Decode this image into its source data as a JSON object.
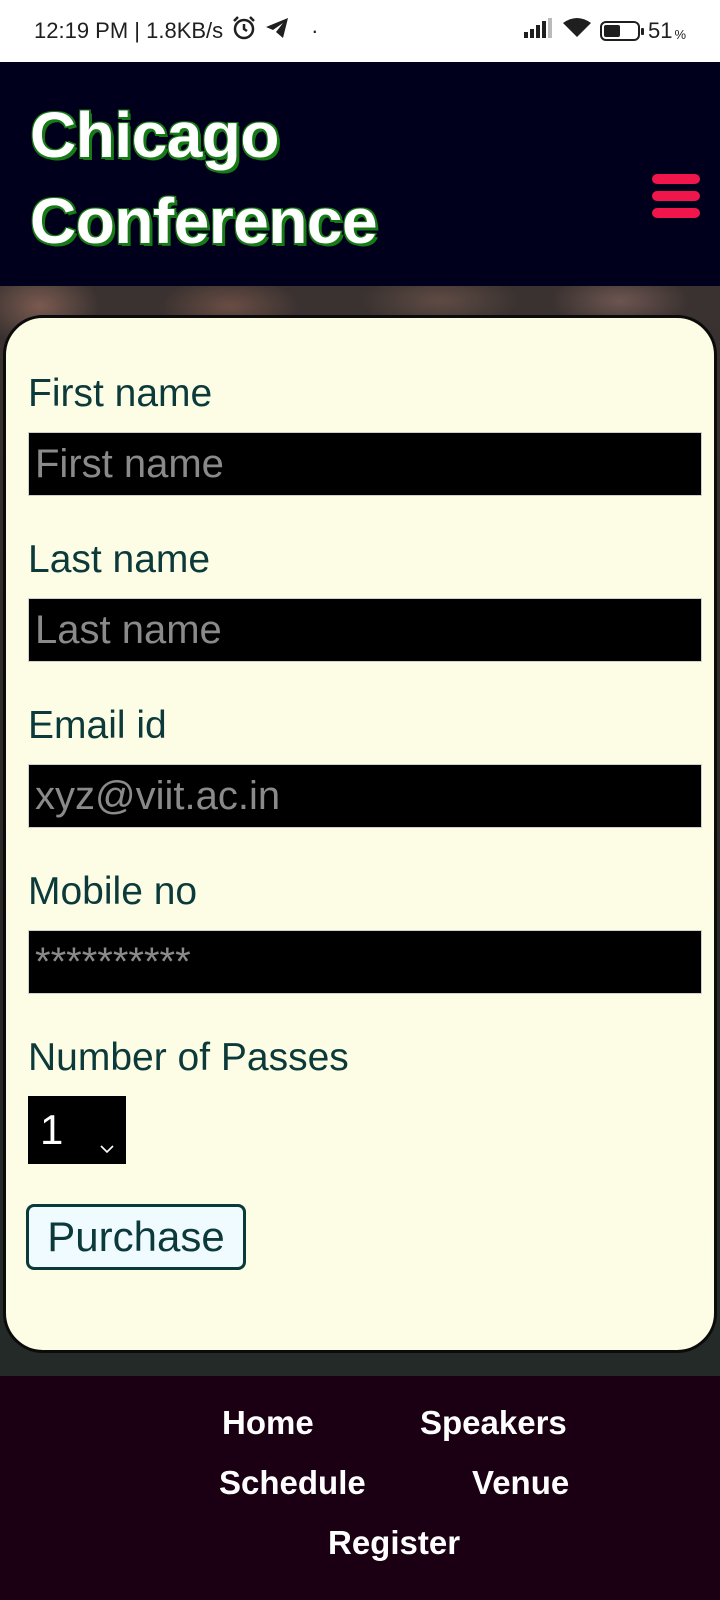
{
  "status_bar": {
    "time_info": "12:19 PM | 1.8KB/s",
    "dot": "·",
    "battery_percent": "51",
    "battery_suffix": "%",
    "battery_level": 0.51
  },
  "header": {
    "title": "Chicago\nConference",
    "title_color": "#ffffff",
    "title_shadow_color": "#167a16",
    "background_color": "#00001c",
    "menu_icon": "hamburger-menu-icon",
    "menu_color": "#f0154a"
  },
  "form": {
    "first_name": {
      "label": "First name",
      "placeholder": "First name"
    },
    "last_name": {
      "label": "Last name",
      "placeholder": "Last name"
    },
    "email": {
      "label": "Email id",
      "placeholder": "xyz@viit.ac.in"
    },
    "mobile": {
      "label": "Mobile no",
      "placeholder": "**********"
    },
    "passes": {
      "label": "Number of Passes",
      "value": "1"
    },
    "purchase_label": "Purchase",
    "card_color": "#fdfde6",
    "label_color": "#0c3a3a"
  },
  "footer": {
    "background_color": "#1a0012",
    "links": {
      "home": "Home",
      "speakers": "Speakers",
      "schedule": "Schedule",
      "venue": "Venue",
      "register": "Register"
    }
  }
}
